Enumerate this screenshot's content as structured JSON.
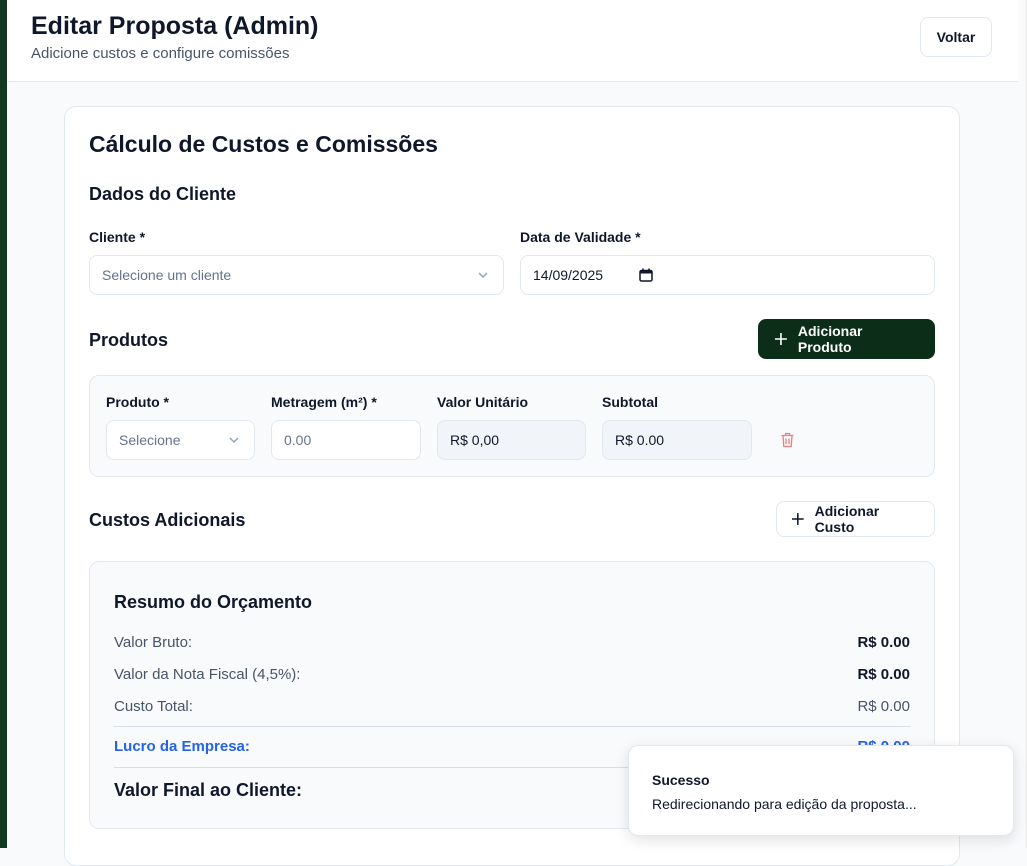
{
  "header": {
    "title": "Editar Proposta (Admin)",
    "subtitle": "Adicione custos e configure comissões",
    "back_label": "Voltar"
  },
  "card": {
    "title": "Cálculo de Custos e Comissões"
  },
  "client_section": {
    "title": "Dados do Cliente",
    "client_label": "Cliente *",
    "client_placeholder": "Selecione um cliente",
    "validity_label": "Data de Validade *",
    "validity_value": "14/09/2025"
  },
  "products": {
    "title": "Produtos",
    "add_label": "Adicionar Produto",
    "row": {
      "product_label": "Produto *",
      "product_placeholder": "Selecione",
      "area_label": "Metragem (m²) *",
      "area_placeholder": "0.00",
      "unit_label": "Valor Unitário",
      "unit_value": "R$ 0,00",
      "subtotal_label": "Subtotal",
      "subtotal_value": "R$ 0.00"
    }
  },
  "costs": {
    "title": "Custos Adicionais",
    "add_label": "Adicionar Custo"
  },
  "summary": {
    "title": "Resumo do Orçamento",
    "gross_label": "Valor Bruto:",
    "gross_value": "R$ 0.00",
    "invoice_label": "Valor da Nota Fiscal (4,5%):",
    "invoice_value": "R$ 0.00",
    "total_cost_label": "Custo Total:",
    "total_cost_value": "R$ 0.00",
    "profit_label": "Lucro da Empresa:",
    "profit_value": "R$ 0.00",
    "final_label": "Valor Final ao Cliente:"
  },
  "toast": {
    "title": "Sucesso",
    "message": "Redirecionando para edição da proposta..."
  },
  "colors": {
    "primary_dark": "#0c2e18",
    "accent_blue": "#2563eb",
    "danger": "#ef4444"
  }
}
